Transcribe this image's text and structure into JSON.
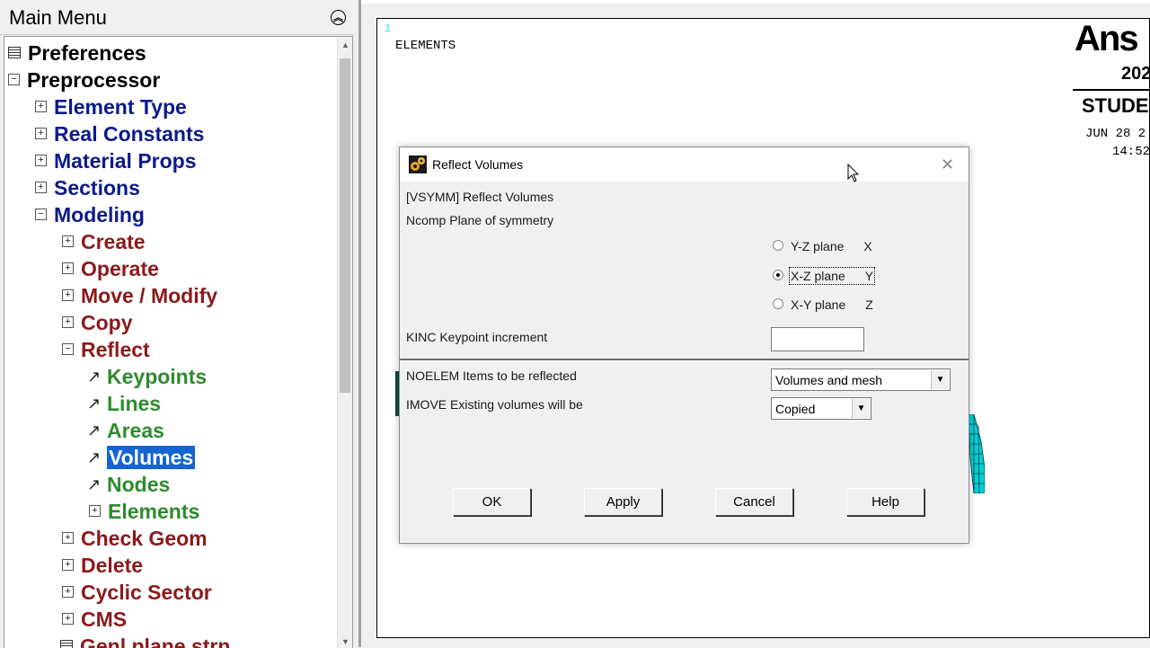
{
  "main_menu": {
    "title": "Main Menu",
    "collapse_icon": "double-chevron-up-icon",
    "items": [
      {
        "label": "Preferences",
        "glyph": "",
        "type": "doc"
      },
      {
        "label": "Preprocessor",
        "glyph": "⊟",
        "type": "expander"
      },
      {
        "label": "Element Type",
        "glyph": "⊞",
        "type": "expander"
      },
      {
        "label": "Real Constants",
        "glyph": "⊞",
        "type": "expander"
      },
      {
        "label": "Material Props",
        "glyph": "⊞",
        "type": "expander"
      },
      {
        "label": "Sections",
        "glyph": "⊞",
        "type": "expander"
      },
      {
        "label": "Modeling",
        "glyph": "⊟",
        "type": "expander"
      },
      {
        "label": "Create",
        "glyph": "⊞",
        "type": "expander"
      },
      {
        "label": "Operate",
        "glyph": "⊞",
        "type": "expander"
      },
      {
        "label": "Move / Modify",
        "glyph": "⊞",
        "type": "expander"
      },
      {
        "label": "Copy",
        "glyph": "⊞",
        "type": "expander"
      },
      {
        "label": "Reflect",
        "glyph": "⊟",
        "type": "expander"
      },
      {
        "label": "Keypoints",
        "glyph": "↗",
        "type": "action"
      },
      {
        "label": "Lines",
        "glyph": "↗",
        "type": "action"
      },
      {
        "label": "Areas",
        "glyph": "↗",
        "type": "action"
      },
      {
        "label": "Volumes",
        "glyph": "↗",
        "type": "action",
        "selected": true
      },
      {
        "label": "Nodes",
        "glyph": "↗",
        "type": "action"
      },
      {
        "label": "Elements",
        "glyph": "⊞",
        "type": "expander"
      },
      {
        "label": "Check Geom",
        "glyph": "⊞",
        "type": "expander"
      },
      {
        "label": "Delete",
        "glyph": "⊞",
        "type": "expander"
      },
      {
        "label": "Cyclic Sector",
        "glyph": "⊞",
        "type": "expander"
      },
      {
        "label": "CMS",
        "glyph": "⊞",
        "type": "expander"
      },
      {
        "label": "Genl plane strn",
        "glyph": "",
        "type": "doc"
      }
    ]
  },
  "graphics": {
    "window_number": "1",
    "plot_label": "ELEMENTS",
    "logo_text": "Ans",
    "year_text": "202",
    "edition_text": "STUDE",
    "date_text": "JUN 28 2",
    "time_text": "14:52"
  },
  "dialog": {
    "title": "Reflect Volumes",
    "command_line": "[VSYMM]  Reflect Volumes",
    "ncomp_label": "Ncomp  Plane of symmetry",
    "planes": [
      {
        "label": "Y-Z plane",
        "axis": "X",
        "checked": false
      },
      {
        "label": "X-Z plane",
        "axis": "Y",
        "checked": true
      },
      {
        "label": "X-Y plane",
        "axis": "Z",
        "checked": false
      }
    ],
    "kinc_label": "KINC    Keypoint increment",
    "kinc_value": "",
    "noelem_label": "NOELEM  Items to be reflected",
    "noelem_value": "Volumes and mesh",
    "imove_label": "IMOVE   Existing volumes will be",
    "imove_value": "Copied",
    "buttons": {
      "ok": "OK",
      "apply": "Apply",
      "cancel": "Cancel",
      "help": "Help"
    }
  },
  "colors": {
    "selection": "#1464d2",
    "mesh": "#00d0d8",
    "tree_navy": "#0b1a8c",
    "tree_red": "#8b1a1a",
    "tree_green": "#2e8b2e"
  }
}
